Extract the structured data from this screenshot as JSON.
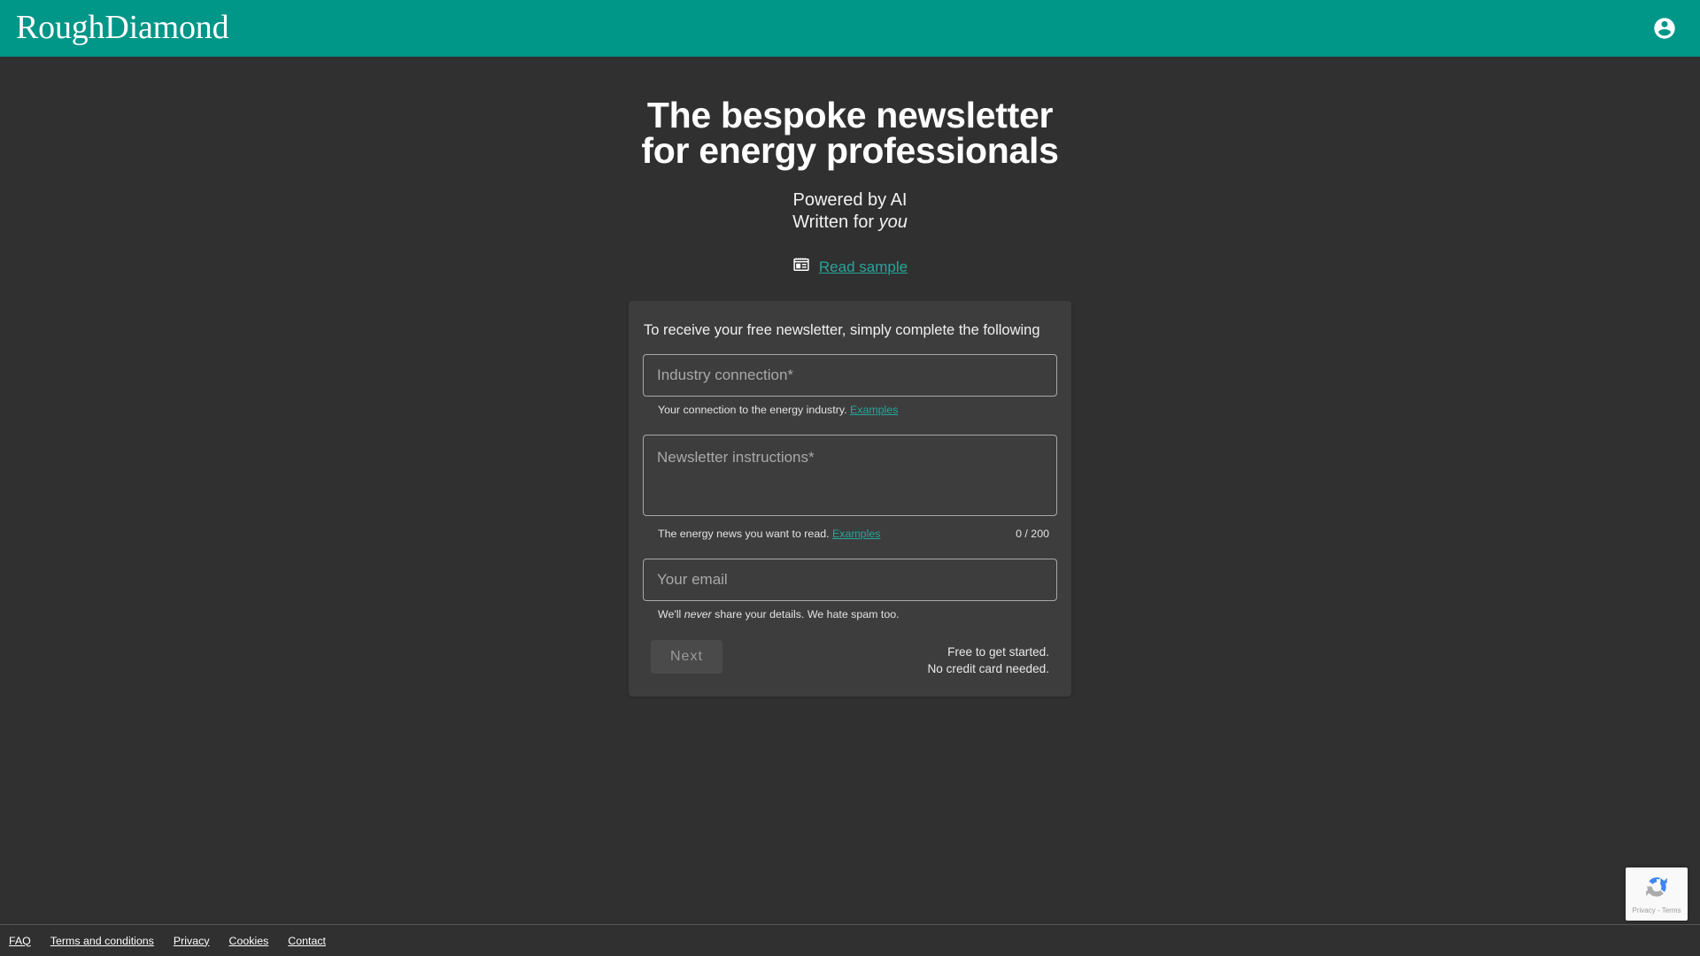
{
  "header": {
    "brand": "RoughDiamond",
    "account_icon": "account-circle-icon",
    "background_color": "#009688"
  },
  "hero": {
    "title_line1": "The bespoke newsletter",
    "title_line2": "for energy professionals",
    "subtitle_line1": "Powered by AI",
    "subtitle_line2_prefix": "Written for ",
    "subtitle_line2_emphasis": "you",
    "sample_icon": "newspaper-icon",
    "sample_link": "Read sample",
    "link_color": "#26a69a"
  },
  "form": {
    "intro": "To receive your free newsletter, simply complete the following",
    "industry": {
      "placeholder": "Industry connection*",
      "value": "",
      "hint": "Your connection to the energy industry.",
      "hint_link": "Examples"
    },
    "instructions": {
      "placeholder": "Newsletter instructions*",
      "value": "",
      "hint": "The energy news you want to read.",
      "hint_link": "Examples",
      "counter": "0 / 200"
    },
    "email": {
      "placeholder": "Your email",
      "value": "",
      "hint_prefix": "We'll ",
      "hint_emphasis": "never",
      "hint_suffix": " share your details. We hate spam too."
    },
    "next_label": "Next",
    "free_note_line1": "Free to get started.",
    "free_note_line2": "No credit card needed."
  },
  "footer": {
    "links": [
      {
        "label": "FAQ"
      },
      {
        "label": "Terms and conditions"
      },
      {
        "label": "Privacy"
      },
      {
        "label": "Cookies"
      },
      {
        "label": "Contact"
      }
    ]
  },
  "recaptcha": {
    "icon": "recaptcha-logo-icon",
    "label": "Privacy - Terms"
  }
}
